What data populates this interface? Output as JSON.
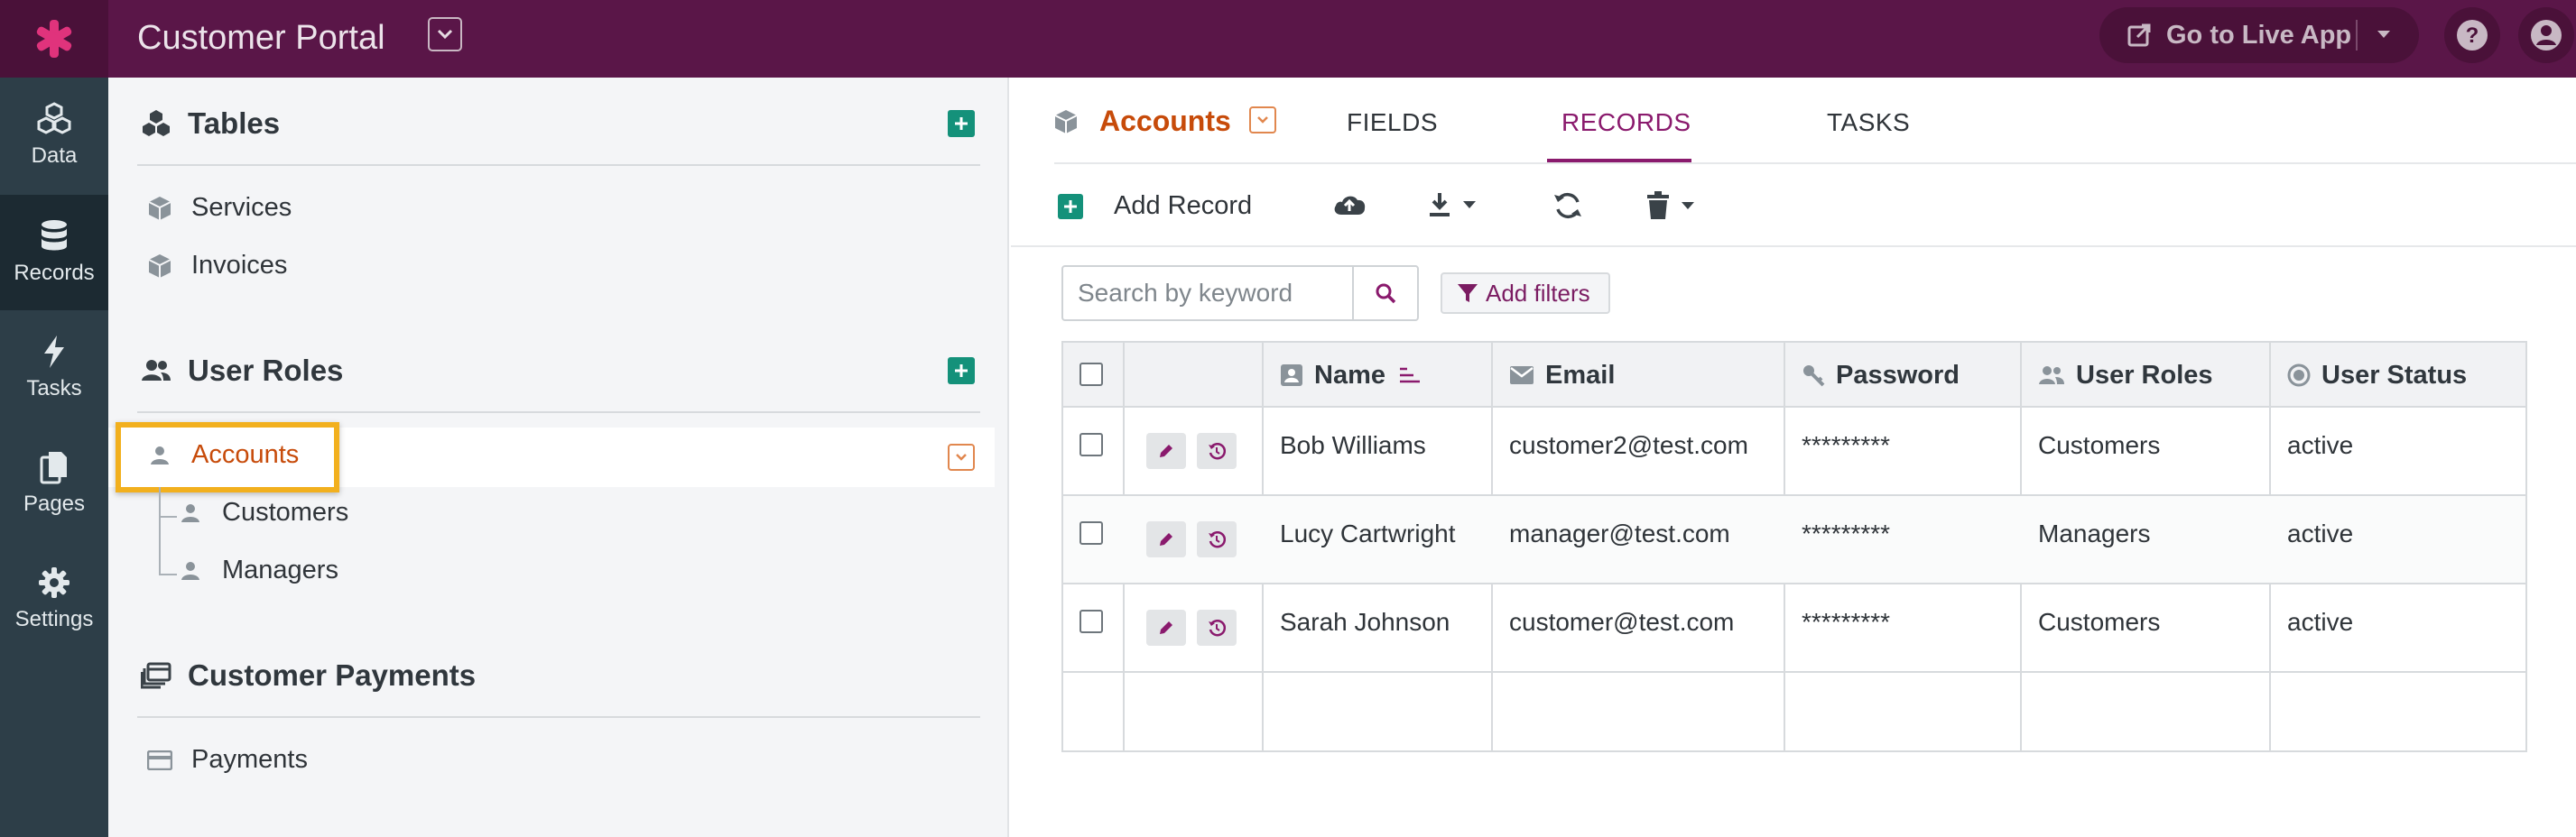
{
  "topbar": {
    "app_title": "Customer Portal",
    "live_app_label": "Go to Live App"
  },
  "rail": {
    "items": [
      {
        "label": "Data",
        "icon": "cubes-icon"
      },
      {
        "label": "Records",
        "icon": "database-icon",
        "active": true
      },
      {
        "label": "Tasks",
        "icon": "bolt-icon"
      },
      {
        "label": "Pages",
        "icon": "pages-icon"
      },
      {
        "label": "Settings",
        "icon": "gear-icon"
      }
    ]
  },
  "sidebar": {
    "tables_heading": "Tables",
    "tables": [
      "Services",
      "Invoices"
    ],
    "roles_heading": "User Roles",
    "roles": {
      "accounts": "Accounts",
      "customers": "Customers",
      "managers": "Managers"
    },
    "payments_heading": "Customer Payments",
    "payments": [
      "Payments"
    ]
  },
  "main": {
    "object_title": "Accounts",
    "tabs": [
      "FIELDS",
      "RECORDS",
      "TASKS"
    ],
    "active_tab": "RECORDS",
    "toolbar": {
      "add_record_label": "Add Record"
    },
    "search": {
      "placeholder": "Search by keyword"
    },
    "filter_label": "Add filters",
    "table": {
      "columns": [
        "Name",
        "Email",
        "Password",
        "User Roles",
        "User Status"
      ],
      "rows": [
        {
          "name": "Bob Williams",
          "email": "customer2@test.com",
          "password": "*********",
          "role": "Customers",
          "status": "active"
        },
        {
          "name": "Lucy Cartwright",
          "email": "manager@test.com",
          "password": "*********",
          "role": "Managers",
          "status": "active"
        },
        {
          "name": "Sarah Johnson",
          "email": "customer@test.com",
          "password": "*********",
          "role": "Customers",
          "status": "active"
        }
      ]
    }
  },
  "colors": {
    "topbar": "#5a1648",
    "accent_purple": "#8a1a6d",
    "accent_orange": "#c74b0a",
    "add_green": "#14917a",
    "highlight_yellow": "#f2b01e",
    "rail": "#2d3e48"
  }
}
